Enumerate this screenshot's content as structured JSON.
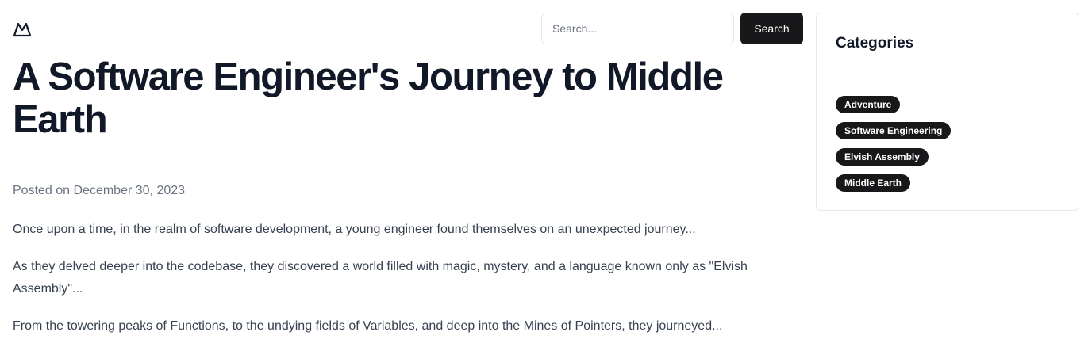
{
  "header": {
    "logo_icon": "mountain-logo-icon",
    "search": {
      "placeholder": "Search...",
      "value": "",
      "button_label": "Search"
    }
  },
  "article": {
    "title": "A Software Engineer's Journey to Middle Earth",
    "posted": "Posted on December 30, 2023",
    "paragraphs": [
      "Once upon a time, in the realm of software development, a young engineer found themselves on an unexpected journey...",
      "As they delved deeper into the codebase, they discovered a world filled with magic, mystery, and a language known only as \"Elvish Assembly\"...",
      "From the towering peaks of Functions, to the undying fields of Variables, and deep into the Mines of Pointers, they journeyed..."
    ]
  },
  "sidebar": {
    "title": "Categories",
    "tags": [
      "Adventure",
      "Software Engineering",
      "Elvish Assembly",
      "Middle Earth"
    ]
  },
  "colors": {
    "text": "#111827",
    "muted": "#6b7280",
    "body": "#374151",
    "button_bg": "#18181b",
    "border": "#e5e7eb"
  }
}
